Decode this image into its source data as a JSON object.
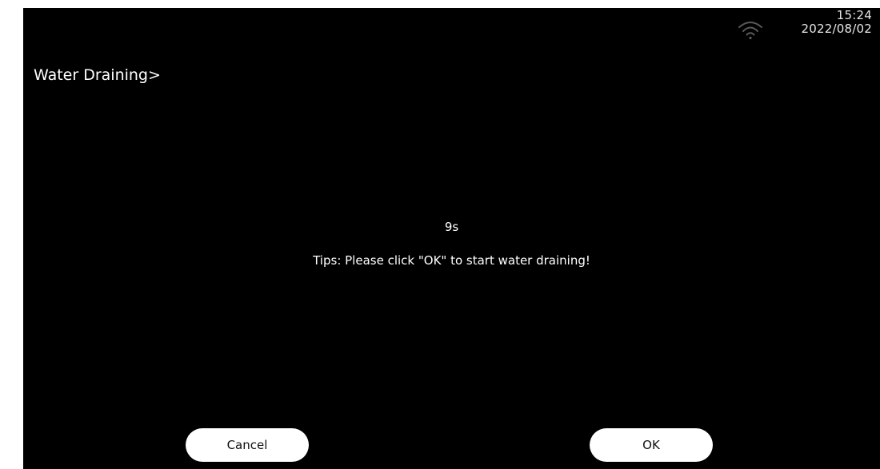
{
  "status_bar": {
    "wifi_icon": "wifi-icon",
    "time": "15:24",
    "date": "2022/08/02"
  },
  "header": {
    "title": "Water Draining>"
  },
  "main": {
    "countdown": "9s",
    "tips": "Tips: Please click \"OK\" to start water draining!"
  },
  "actions": {
    "cancel_label": "Cancel",
    "ok_label": "OK"
  },
  "colors": {
    "background": "#000000",
    "text": "#ffffff",
    "button_bg": "#ffffff",
    "button_text": "#111111"
  }
}
